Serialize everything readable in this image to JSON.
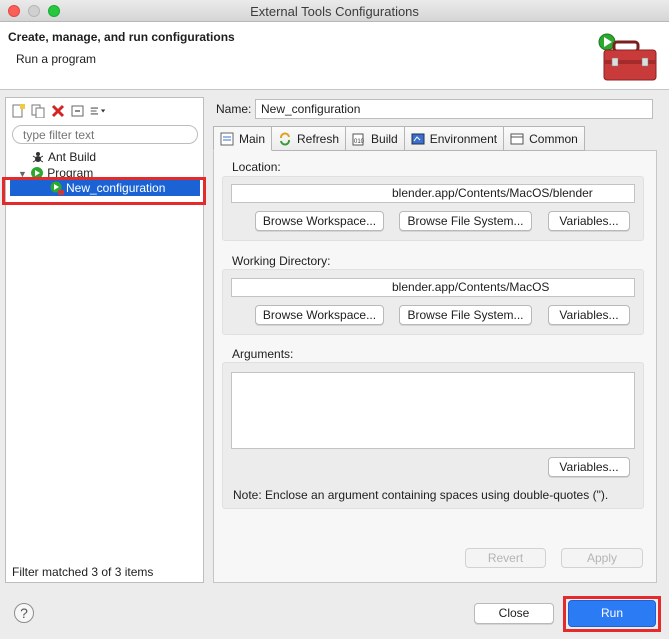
{
  "window": {
    "title": "External Tools Configurations"
  },
  "header": {
    "title": "Create, manage, and run configurations",
    "subtitle": "Run a program"
  },
  "left": {
    "filter_placeholder": "type filter text",
    "tree": {
      "ant": "Ant Build",
      "program": "Program",
      "selected": "New_configuration"
    },
    "status": "Filter matched 3 of 3 items"
  },
  "editor": {
    "name_label": "Name:",
    "name_value": "New_configuration",
    "tabs": [
      "Main",
      "Refresh",
      "Build",
      "Environment",
      "Common"
    ],
    "location": {
      "label": "Location:",
      "value": "blender.app/Contents/MacOS/blender"
    },
    "workdir": {
      "label": "Working Directory:",
      "value": "blender.app/Contents/MacOS"
    },
    "arguments": {
      "label": "Arguments:",
      "note": "Note: Enclose an argument containing spaces using double-quotes (\")."
    },
    "buttons": {
      "browse_workspace": "Browse Workspace...",
      "browse_fs": "Browse File System...",
      "variables": "Variables...",
      "revert": "Revert",
      "apply": "Apply"
    }
  },
  "footer": {
    "help": "?",
    "close": "Close",
    "run": "Run"
  },
  "colors": {
    "selection": "#1b63d5",
    "run_button": "#2a7bf4",
    "highlight": "#e42a2a"
  }
}
